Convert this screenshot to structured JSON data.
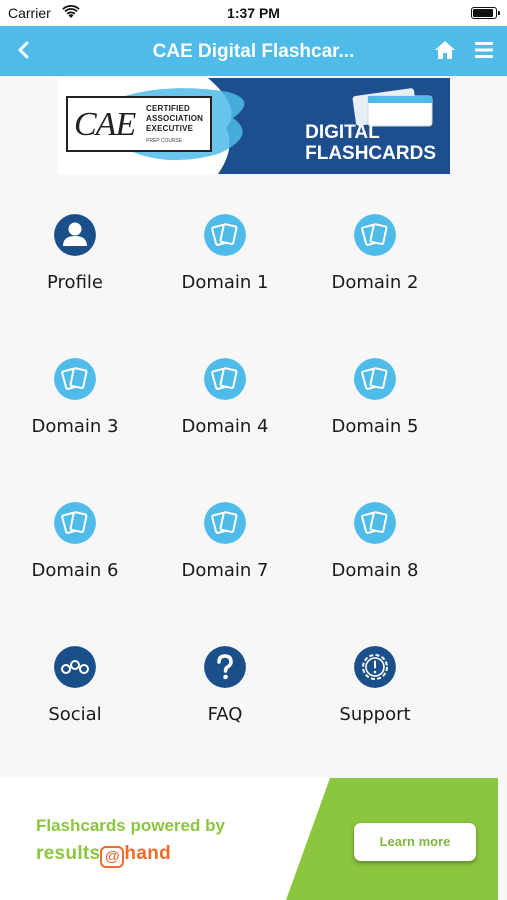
{
  "status_bar": {
    "carrier": "Carrier",
    "time": "1:37 PM"
  },
  "nav": {
    "title": "CAE Digital Flashcar...",
    "accent": "#4fbbe9"
  },
  "banner": {
    "logo": "CAE",
    "logo_lines": [
      "CERTIFIED",
      "ASSOCIATION",
      "EXECUTIVE"
    ],
    "logo_sub": "PREP COURSE",
    "title_line1": "DIGITAL",
    "title_line2": "FLASHCARDS"
  },
  "tiles": [
    {
      "label": "Profile",
      "icon": "profile-icon"
    },
    {
      "label": "Domain 1",
      "icon": "flashcards-icon"
    },
    {
      "label": "Domain 2",
      "icon": "flashcards-icon"
    },
    {
      "label": "Domain 3",
      "icon": "flashcards-icon"
    },
    {
      "label": "Domain 4",
      "icon": "flashcards-icon"
    },
    {
      "label": "Domain 5",
      "icon": "flashcards-icon"
    },
    {
      "label": "Domain 6",
      "icon": "flashcards-icon"
    },
    {
      "label": "Domain 7",
      "icon": "flashcards-icon"
    },
    {
      "label": "Domain 8",
      "icon": "flashcards-icon"
    },
    {
      "label": "Social",
      "icon": "social-icon"
    },
    {
      "label": "FAQ",
      "icon": "faq-icon"
    },
    {
      "label": "Support",
      "icon": "support-icon"
    }
  ],
  "ad": {
    "line1": "Flashcards powered by",
    "brand_left": "results",
    "brand_at": "@",
    "brand_right": "hand",
    "button": "Learn more",
    "green": "#8cc63f"
  }
}
